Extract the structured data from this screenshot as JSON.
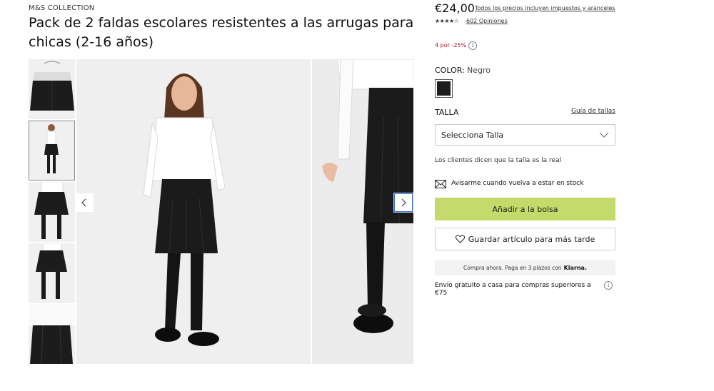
{
  "product": {
    "brand": "M&S COLLECTION",
    "title": "Pack de 2 faldas escolares resistentes a las arrugas para chicas (2-16 años)",
    "price": "€24,00",
    "tax_note": "Todos los precios incluyen impuestos y aranceles",
    "rating_stars": "★★★★☆",
    "rating_value": 4,
    "reviews": "602 Opiniones",
    "promo": "4 por -25%",
    "info_glyph": "i"
  },
  "color": {
    "label": "COLOR:",
    "value": "Negro",
    "swatch": "#1d1d1d"
  },
  "size": {
    "label": "TALLA",
    "guide": "Guía de tallas",
    "placeholder": "Selecciona Talla",
    "fit_note": "Los clientes dicen que la talla es la real"
  },
  "actions": {
    "notify": "Avisarme cuando vuelva a estar en stock",
    "add_to_bag": "Añadir a la bolsa",
    "save": "Guardar artículo para más tarde",
    "add_color": "#c4da6b"
  },
  "klarna": {
    "text": "Compra ahora. Paga en 3 plazos con",
    "brand": "Klarna."
  },
  "shipping": {
    "text": "Envío gratuito a casa para compras superiores a €75"
  },
  "icons": {
    "prev": "chevron-left-icon",
    "next": "chevron-right-icon",
    "dropdown": "chevron-down-icon",
    "notify": "envelope-icon",
    "save": "heart-icon",
    "info": "info-icon"
  }
}
